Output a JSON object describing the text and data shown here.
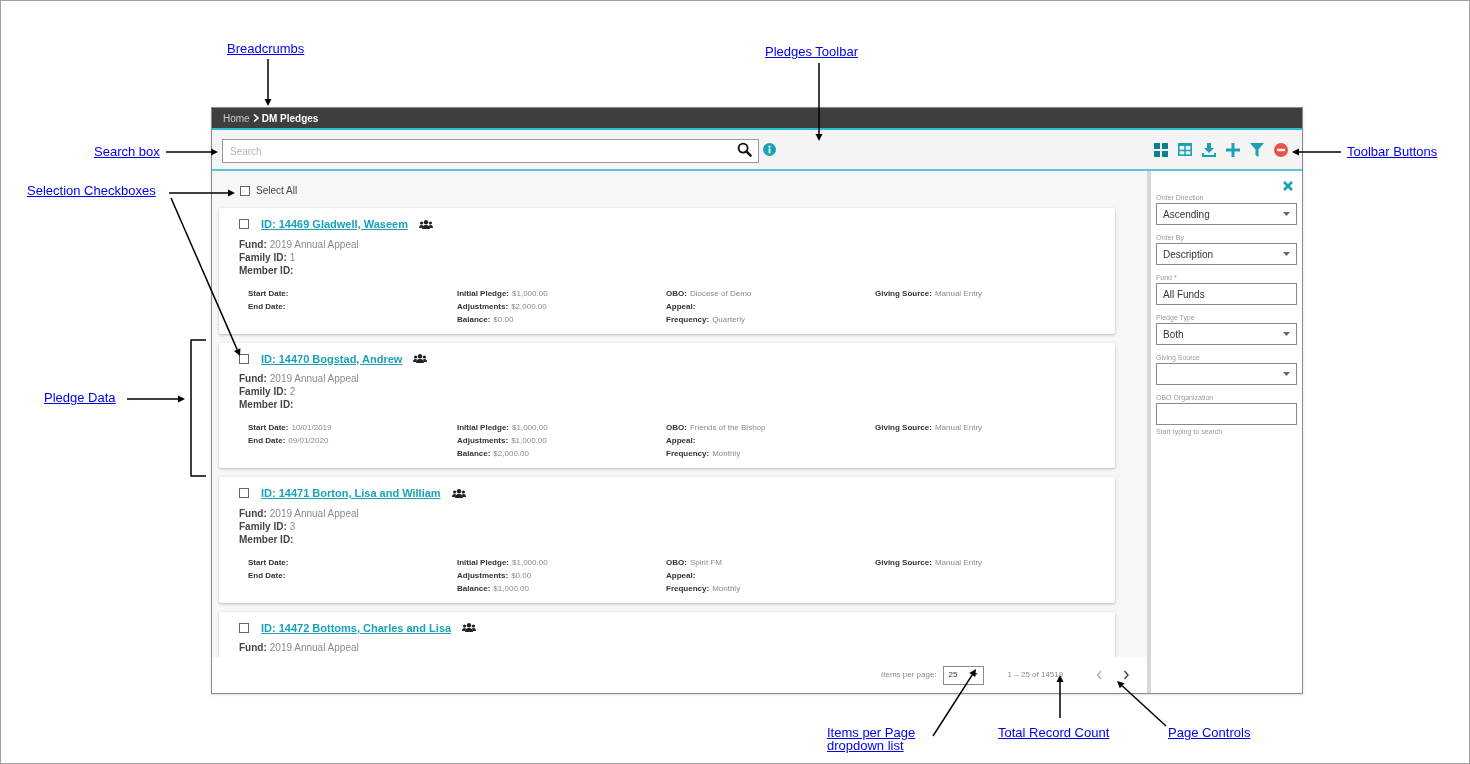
{
  "annotations": [
    {
      "kind": "breadcrumbs",
      "label": "Breadcrumbs"
    },
    {
      "kind": "toolbar",
      "label": "Pledges Toolbar"
    },
    {
      "kind": "search",
      "label": "Search box"
    },
    {
      "kind": "checkboxes",
      "label": "Selection Checkboxes"
    },
    {
      "kind": "data",
      "label": "Pledge Data"
    },
    {
      "kind": "buttons",
      "label": "Toolbar Buttons"
    },
    {
      "kind": "perpage",
      "label": "Items per Page dropdown list"
    },
    {
      "kind": "count",
      "label": "Total Record Count"
    },
    {
      "kind": "pager",
      "label": "Page Controls"
    }
  ],
  "breadcrumbs": [
    {
      "label": "Home",
      "current": false
    },
    {
      "label": "DM Pledges",
      "current": true
    }
  ],
  "search": {
    "placeholder": "Search"
  },
  "select_all": {
    "label": "Select All",
    "checked": false
  },
  "pledges": [
    {
      "title": "ID: 14469 Gladwell, Waseem",
      "checked": false,
      "fields": [
        {
          "label": "Fund:",
          "value": "2019 Annual Appeal"
        },
        {
          "label": "Family ID:",
          "value": "1"
        },
        {
          "label": "Member ID:"
        }
      ],
      "details": [
        [
          {
            "label": "Start Date:"
          },
          {
            "label": "End Date:"
          }
        ],
        [
          {
            "label": "Initial Pledge:",
            "value": "$1,000.00"
          },
          {
            "label": "Adjustments:",
            "value": "$2,000.00"
          },
          {
            "label": "Balance:",
            "value": "$0.00"
          }
        ],
        [
          {
            "label": "OBO:",
            "value": "Diocese of Demo"
          },
          {
            "label": "Appeal:"
          },
          {
            "label": "Frequency:",
            "value": "Quarterly"
          }
        ],
        [
          {
            "label": "Giving Source:",
            "value": "Manual Entry"
          }
        ]
      ]
    },
    {
      "title": "ID: 14470 Bogstad, Andrew",
      "checked": false,
      "fields": [
        {
          "label": "Fund:",
          "value": "2019 Annual Appeal"
        },
        {
          "label": "Family ID:",
          "value": "2"
        },
        {
          "label": "Member ID:"
        }
      ],
      "details": [
        [
          {
            "label": "Start Date:",
            "value": "10/01/2019"
          },
          {
            "label": "End Date:",
            "value": "09/01/2020"
          }
        ],
        [
          {
            "label": "Initial Pledge:",
            "value": "$1,000.00"
          },
          {
            "label": "Adjustments:",
            "value": "$1,000.00"
          },
          {
            "label": "Balance:",
            "value": "$2,000.00"
          }
        ],
        [
          {
            "label": "OBO:",
            "value": "Friends of the Bishop"
          },
          {
            "label": "Appeal:"
          },
          {
            "label": "Frequency:",
            "value": "Monthly"
          }
        ],
        [
          {
            "label": "Giving Source:",
            "value": "Manual Entry"
          }
        ]
      ]
    },
    {
      "title": "ID: 14471 Borton, Lisa and William",
      "checked": false,
      "fields": [
        {
          "label": "Fund:",
          "value": "2019 Annual Appeal"
        },
        {
          "label": "Family ID:",
          "value": "3"
        },
        {
          "label": "Member ID:"
        }
      ],
      "details": [
        [
          {
            "label": "Start Date:"
          },
          {
            "label": "End Date:"
          }
        ],
        [
          {
            "label": "Initial Pledge:",
            "value": "$1,000.00"
          },
          {
            "label": "Adjustments:",
            "value": "$0.00"
          },
          {
            "label": "Balance:",
            "value": "$1,000.00"
          }
        ],
        [
          {
            "label": "OBO:",
            "value": "Spirit FM"
          },
          {
            "label": "Appeal:"
          },
          {
            "label": "Frequency:",
            "value": "Monthly"
          }
        ],
        [
          {
            "label": "Giving Source:",
            "value": "Manual Entry"
          }
        ]
      ]
    },
    {
      "title": "ID: 14472 Bottoms, Charles and Lisa",
      "checked": false,
      "fields": [
        {
          "label": "Fund:",
          "value": "2019 Annual Appeal"
        }
      ]
    }
  ],
  "filter_panel": {
    "fields": [
      {
        "kind": "select",
        "label": "Order Direction",
        "value": "Ascending"
      },
      {
        "kind": "select",
        "label": "Order By",
        "value": "Description"
      },
      {
        "kind": "input",
        "label": "Fund *",
        "value": "All Funds"
      },
      {
        "kind": "select",
        "label": "Pledge Type",
        "value": "Both"
      },
      {
        "kind": "select",
        "label": "Giving Source"
      },
      {
        "kind": "input",
        "label": "OBO Organization",
        "hint": "Start typing to search"
      }
    ]
  },
  "pagination": {
    "items_per_page_label": "Items per page:",
    "items_per_page": "25",
    "range": "1 – 25 of 14519"
  }
}
